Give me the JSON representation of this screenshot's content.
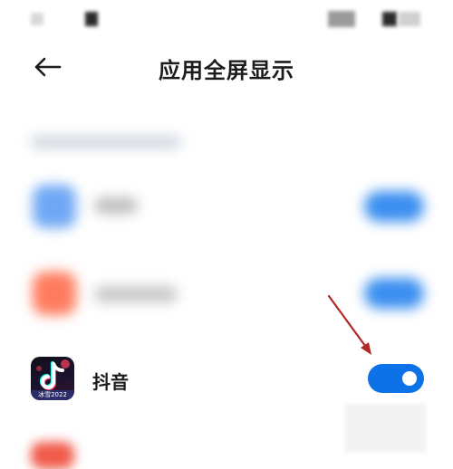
{
  "status_bar": {},
  "header": {
    "back_icon": "arrow-left-icon",
    "title": "应用全屏显示"
  },
  "blurred_rows": [
    {
      "icon_color": "#6fa8f5",
      "toggle_color": "#3b8ff0"
    },
    {
      "icon_color": "#ff7b5e",
      "toggle_color": "#3b8ff0"
    }
  ],
  "app_row": {
    "icon": "douyin-app-icon",
    "icon_caption": "冰雪2022",
    "name": "抖音",
    "toggle_state": "on",
    "toggle_color": "#0d72e8"
  },
  "annotation": {
    "arrow_color": "#b02828"
  }
}
